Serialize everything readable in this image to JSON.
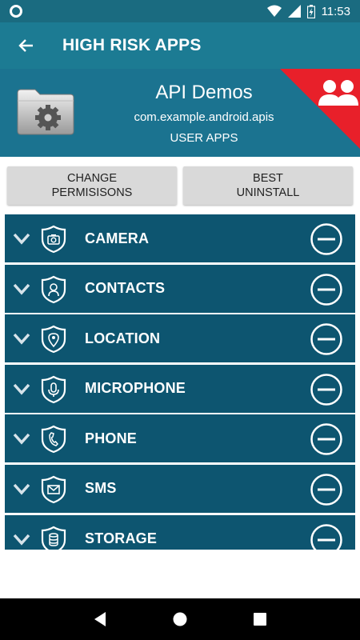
{
  "status_bar": {
    "time": "11:53"
  },
  "toolbar": {
    "title": "HIGH RISK APPS"
  },
  "app": {
    "name": "API Demos",
    "package": "com.example.android.apis",
    "type": "USER APPS"
  },
  "actions": {
    "change_permissions": "CHANGE\nPERMISISONS",
    "best_uninstall": "BEST\nUNINSTALL"
  },
  "permissions": [
    {
      "label": "CAMERA",
      "icon": "camera-icon"
    },
    {
      "label": "CONTACTS",
      "icon": "contacts-icon"
    },
    {
      "label": "LOCATION",
      "icon": "location-icon"
    },
    {
      "label": "MICROPHONE",
      "icon": "microphone-icon"
    },
    {
      "label": "PHONE",
      "icon": "phone-icon"
    },
    {
      "label": "SMS",
      "icon": "sms-icon"
    },
    {
      "label": "STORAGE",
      "icon": "storage-icon"
    }
  ],
  "colors": {
    "status_bar": "#1a6b80",
    "toolbar": "#1c7b93",
    "header": "#1b7390",
    "row": "#0d5570",
    "risk_corner": "#e8202a"
  }
}
